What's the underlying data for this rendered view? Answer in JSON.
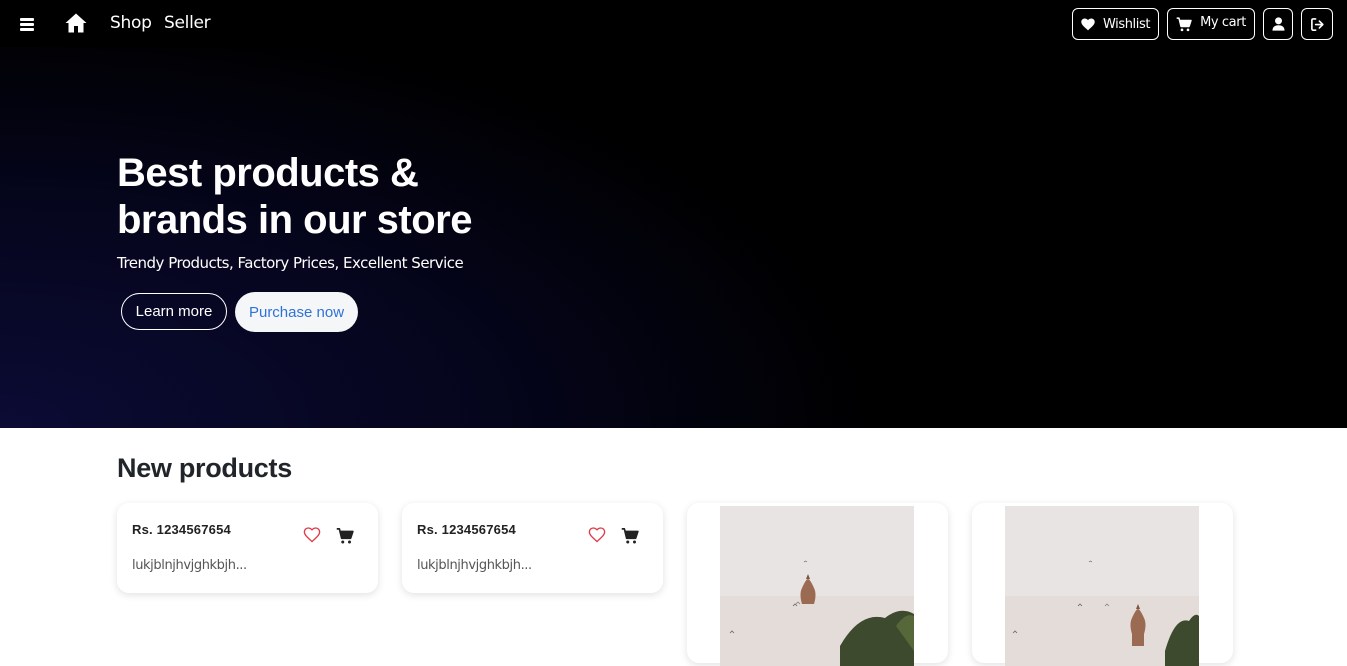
{
  "navbar": {
    "links": {
      "shop": "Shop",
      "seller": "Seller"
    },
    "wishlist_label": "Wishlist",
    "cart_label": "My cart",
    "icons": {
      "menu": "hamburger-icon",
      "home": "home-icon",
      "wishlist": "heart-icon",
      "cart": "cart-icon",
      "user": "user-icon",
      "logout": "logout-icon"
    }
  },
  "hero": {
    "title": "Best products & brands in our store",
    "subtitle": "Trendy Products, Factory Prices, Excellent Service",
    "learn_more_label": "Learn more",
    "purchase_label": "Purchase now"
  },
  "new_products": {
    "title": "New products",
    "items": [
      {
        "price": "Rs. 1234567654",
        "description": "lukjblnjhvjghkbjh..."
      },
      {
        "price": "Rs. 1234567654",
        "description": "lukjblnjhvjghkbjh..."
      }
    ]
  },
  "colors": {
    "navbar_bg": "#000000",
    "hero_bg": "#05051c",
    "purchase_text": "#2f72d8",
    "heart": "#e0394a"
  }
}
